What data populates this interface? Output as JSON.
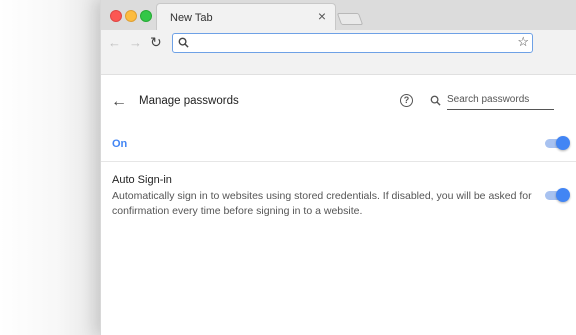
{
  "browser": {
    "tab": {
      "title": "New Tab",
      "close_glyph": "×"
    },
    "toolbar": {
      "back_glyph": "←",
      "forward_glyph": "→",
      "reload_glyph": "↻",
      "address_value": "",
      "star_glyph": "☆"
    }
  },
  "page": {
    "back_glyph": "←",
    "title": "Manage passwords",
    "help_glyph": "?",
    "search": {
      "placeholder": "Search passwords",
      "value": ""
    },
    "on_row": {
      "label": "On",
      "enabled": true
    },
    "auto_signin": {
      "title": "Auto Sign-in",
      "description": "Automatically sign in to websites using stored credentials. If disabled, you will be asked for confirmation every time before signing in to a website.",
      "enabled": true
    }
  },
  "colors": {
    "accent": "#4285f4",
    "toggle_track": "#a8c2f0",
    "traffic_red": "#fc5753",
    "traffic_yellow": "#fdbc40",
    "traffic_green": "#33c748"
  }
}
